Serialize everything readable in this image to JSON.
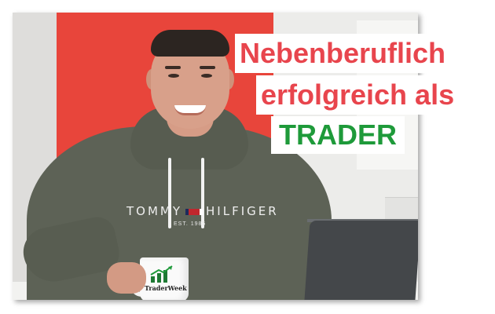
{
  "headline": {
    "line1": "Nebenberuflich",
    "line2": "erfolgreich als",
    "line3": "TRADER"
  },
  "hoodie_brand": {
    "left": "TOMMY",
    "right": "HILFIGER",
    "est": "EST. 1985"
  },
  "mug": {
    "text": "TraderWeek"
  },
  "colors": {
    "headline_red": "#e8454d",
    "headline_green": "#1e9a3a",
    "red_panel": "#e8453b",
    "hoodie": "#5d6256"
  }
}
